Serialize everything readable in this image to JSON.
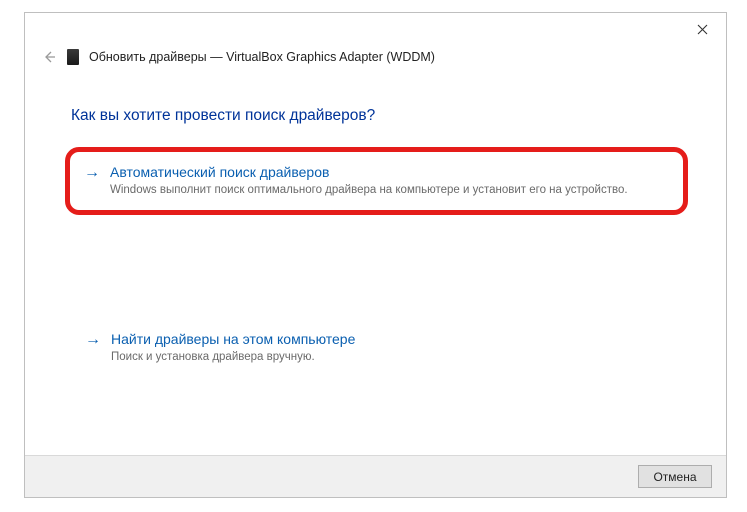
{
  "titlebar": {
    "title": "Обновить драйверы — VirtualBox Graphics Adapter (WDDM)"
  },
  "question": "Как вы хотите провести поиск драйверов?",
  "options": {
    "auto": {
      "title": "Автоматический поиск драйверов",
      "desc": "Windows выполнит поиск оптимального драйвера на компьютере и установит его на устройство."
    },
    "manual": {
      "title": "Найти драйверы на этом компьютере",
      "desc": "Поиск и установка драйвера вручную."
    }
  },
  "footer": {
    "cancel": "Отмена"
  }
}
